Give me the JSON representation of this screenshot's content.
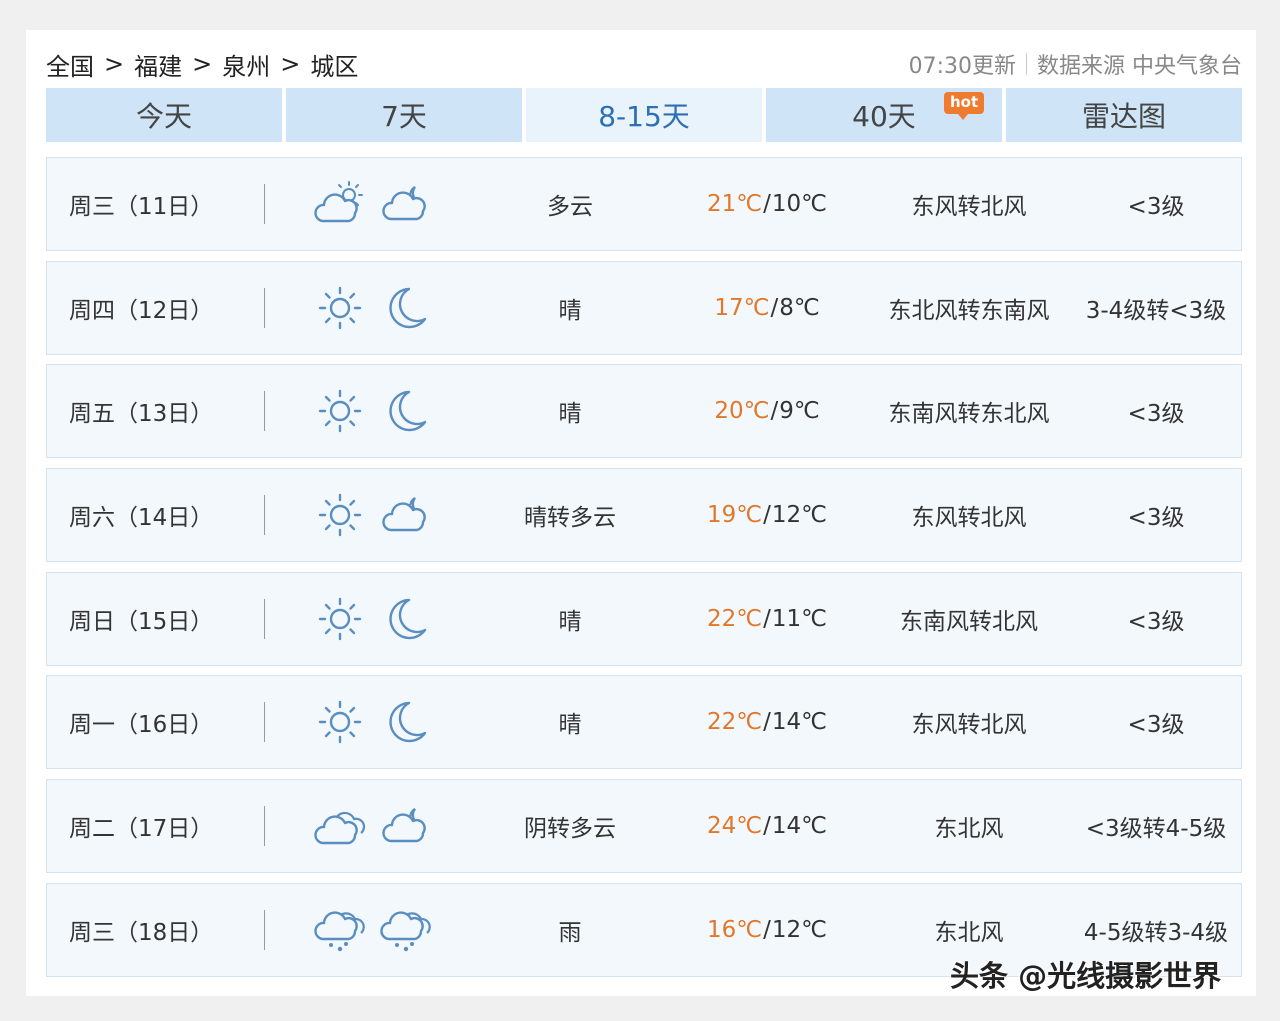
{
  "breadcrumb": [
    "全国",
    "福建",
    "泉州",
    "城区"
  ],
  "breadcrumb_sep": ">",
  "header": {
    "updated": "07:30更新",
    "source": "数据来源 中央气象台"
  },
  "tabs": [
    {
      "label": "今天",
      "active": false
    },
    {
      "label": "7天",
      "active": false
    },
    {
      "label": "8-15天",
      "active": true
    },
    {
      "label": "40天",
      "active": false,
      "badge": "hot"
    },
    {
      "label": "雷达图",
      "active": false
    }
  ],
  "colors": {
    "tab_bg": "#cfe5f7",
    "tab_active_bg": "#e8f3fc",
    "tab_active_text": "#2d6fb5",
    "high_temp": "#e0782b",
    "hot_badge": "#f07a2d",
    "row_bg": "#f3f8fd",
    "icon_stroke": "#5a8ec0"
  },
  "forecast": [
    {
      "day": "周三（11日）",
      "icon_day": "cloud-sun-icon",
      "icon_night": "cloud-moon-icon",
      "weather": "多云",
      "high": "21℃",
      "low": "10℃",
      "wind": "东风转北风",
      "level": "<3级"
    },
    {
      "day": "周四（12日）",
      "icon_day": "sun-icon",
      "icon_night": "moon-icon",
      "weather": "晴",
      "high": "17℃",
      "low": "8℃",
      "wind": "东北风转东南风",
      "level": "3-4级转<3级"
    },
    {
      "day": "周五（13日）",
      "icon_day": "sun-icon",
      "icon_night": "moon-icon",
      "weather": "晴",
      "high": "20℃",
      "low": "9℃",
      "wind": "东南风转东北风",
      "level": "<3级"
    },
    {
      "day": "周六（14日）",
      "icon_day": "sun-icon",
      "icon_night": "cloud-moon-icon",
      "weather": "晴转多云",
      "high": "19℃",
      "low": "12℃",
      "wind": "东风转北风",
      "level": "<3级"
    },
    {
      "day": "周日（15日）",
      "icon_day": "sun-icon",
      "icon_night": "moon-icon",
      "weather": "晴",
      "high": "22℃",
      "low": "11℃",
      "wind": "东南风转北风",
      "level": "<3级"
    },
    {
      "day": "周一（16日）",
      "icon_day": "sun-icon",
      "icon_night": "moon-icon",
      "weather": "晴",
      "high": "22℃",
      "low": "14℃",
      "wind": "东风转北风",
      "level": "<3级"
    },
    {
      "day": "周二（17日）",
      "icon_day": "overcast-icon",
      "icon_night": "cloud-moon-icon",
      "weather": "阴转多云",
      "high": "24℃",
      "low": "14℃",
      "wind": "东北风",
      "level": "<3级转4-5级"
    },
    {
      "day": "周三（18日）",
      "icon_day": "rain-icon",
      "icon_night": "rain-icon",
      "weather": "雨",
      "high": "16℃",
      "low": "12℃",
      "wind": "东北风",
      "level": "4-5级转3-4级"
    }
  ],
  "watermark": "头条 @光线摄影世界"
}
